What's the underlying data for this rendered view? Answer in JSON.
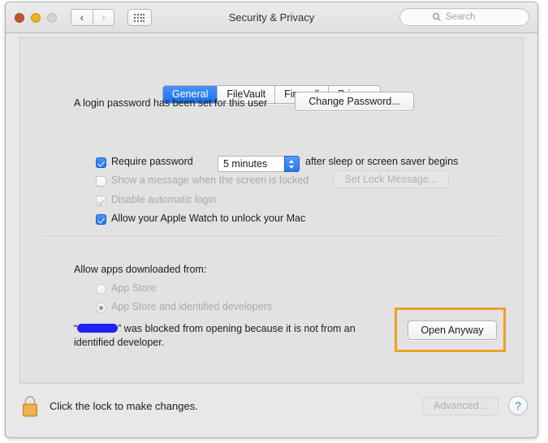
{
  "window": {
    "title": "Security & Privacy",
    "traffic_lights": [
      "close",
      "minimize",
      "maximize"
    ],
    "nav": {
      "back": "‹",
      "forward": "›"
    },
    "grid_icon": "grid-icon"
  },
  "search": {
    "placeholder": "Search",
    "icon": "search-icon"
  },
  "tabs": [
    {
      "label": "General",
      "selected": true
    },
    {
      "label": "FileVault",
      "selected": false
    },
    {
      "label": "Firewall",
      "selected": false
    },
    {
      "label": "Privacy",
      "selected": false
    }
  ],
  "general": {
    "password_status": "A login password has been set for this user",
    "change_password_label": "Change Password...",
    "require_password": {
      "label": "Require password",
      "checked": true,
      "enabled": true,
      "delay_value": "5 minutes",
      "suffix": "after sleep or screen saver begins"
    },
    "show_message": {
      "label": "Show a message when the screen is locked",
      "checked": false,
      "enabled": false,
      "button_label": "Set Lock Message..."
    },
    "disable_auto_login": {
      "label": "Disable automatic login",
      "checked": true,
      "enabled": false
    },
    "apple_watch": {
      "label": "Allow your Apple Watch to unlock your Mac",
      "checked": true,
      "enabled": true
    }
  },
  "gatekeeper": {
    "heading": "Allow apps downloaded from:",
    "options": [
      {
        "label": "App Store",
        "selected": false,
        "enabled": false
      },
      {
        "label": "App Store and identified developers",
        "selected": true,
        "enabled": false
      }
    ],
    "blocked_message_prefix": "“",
    "blocked_app_name_redacted": true,
    "blocked_message_suffix": "” was blocked from opening because it is not from an identified developer.",
    "open_anyway_label": "Open Anyway",
    "highlight_color": "#efa024"
  },
  "footer": {
    "lock_icon": "lock-closed-icon",
    "lock_text": "Click the lock to make changes.",
    "advanced_label": "Advanced...",
    "advanced_enabled": false,
    "help_label": "?"
  }
}
